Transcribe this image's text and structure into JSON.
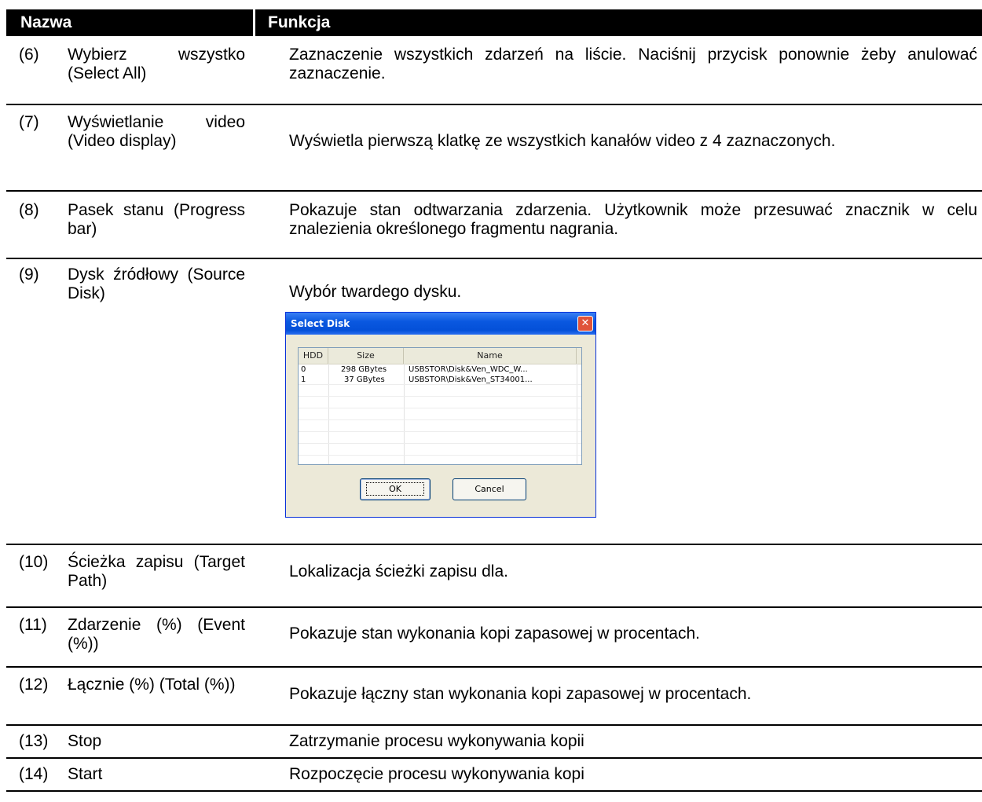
{
  "header": {
    "name": "Nazwa",
    "function": "Funkcja"
  },
  "rows": [
    {
      "num": "(6)",
      "name": "Wybierz wszystko (Select All)",
      "func": "Zaznaczenie wszystkich zdarzeń na liście. Naciśnij przycisk ponownie żeby anulować zaznaczenie."
    },
    {
      "num": "(7)",
      "name": "Wyświetlanie video (Video display)",
      "func": "Wyświetla pierwszą klatkę ze wszystkich kanałów video z 4 zaznaczonych."
    },
    {
      "num": "(8)",
      "name": "Pasek stanu (Progress bar)",
      "func": "Pokazuje stan odtwarzania zdarzenia. Użytkownik może przesuwać znacznik w celu znalezienia określonego fragmentu nagrania."
    },
    {
      "num": "(9)",
      "name": "Dysk źródłowy (Source Disk)",
      "func": "Wybór twardego dysku."
    },
    {
      "num": "(10)",
      "name": "Ścieżka zapisu (Target Path)",
      "func": "Lokalizacja ścieżki zapisu dla."
    },
    {
      "num": "(11)",
      "name": "Zdarzenie (%) (Event (%))",
      "func": "Pokazuje stan wykonania kopi zapasowej w procentach."
    },
    {
      "num": "(12)",
      "name": "Łącznie (%) (Total (%))",
      "func": "Pokazuje łączny stan wykonania kopi zapasowej w procentach."
    },
    {
      "num": "(13)",
      "name": "Stop",
      "func": "Zatrzymanie procesu wykonywania kopii"
    },
    {
      "num": "(14)",
      "name": "Start",
      "func": "Rozpoczęcie procesu wykonywania kopi"
    }
  ],
  "dialog": {
    "title": "Select Disk",
    "columns": [
      "HDD",
      "Size",
      "Name"
    ],
    "disks": [
      {
        "hdd": "0",
        "size": "298 GBytes",
        "name": "USBSTOR\\Disk&Ven_WDC_W..."
      },
      {
        "hdd": "1",
        "size": "37 GBytes",
        "name": "USBSTOR\\Disk&Ven_ST34001..."
      }
    ],
    "ok_label": "OK",
    "cancel_label": "Cancel"
  }
}
